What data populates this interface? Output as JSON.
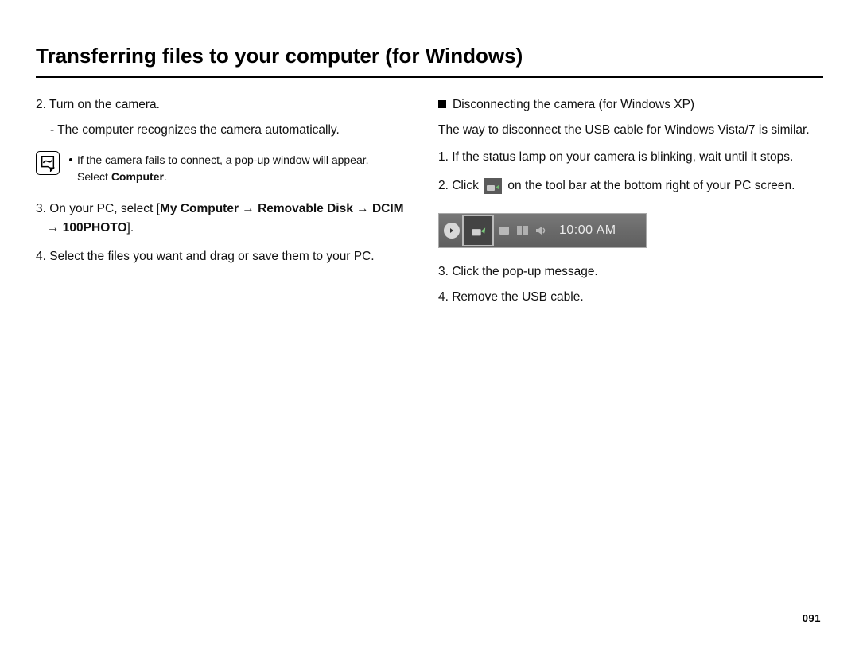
{
  "title": "Transferring files to your computer (for Windows)",
  "left": {
    "step2": "2. Turn on the camera.",
    "step2sub": "- The computer recognizes the camera automatically.",
    "note_line_a": "If the camera fails to connect, a pop-up window will appear.",
    "note_line_b_prefix": "Select ",
    "note_line_b_bold": "Computer",
    "note_line_b_suffix": ".",
    "step3_prefix": "3. On your PC, select [",
    "step3_bold": "My Computer → Removable Disk → DCIM → 100PHOTO",
    "step3_suffix": "].",
    "step4": "4. Select the files you want and drag or save them to your PC."
  },
  "right": {
    "subheading": "Disconnecting the camera (for Windows XP)",
    "intro": "The way to disconnect the USB cable for Windows Vista/7 is similar.",
    "step1": "1. If the status lamp on your camera is blinking, wait until it stops.",
    "step2_prefix": "2. Click ",
    "step2_suffix": " on the tool bar at the bottom right of your PC screen.",
    "tray_time": "10:00 AM",
    "step3": "3. Click the pop-up message.",
    "step4": "4. Remove the USB cable."
  },
  "page_number": "091"
}
